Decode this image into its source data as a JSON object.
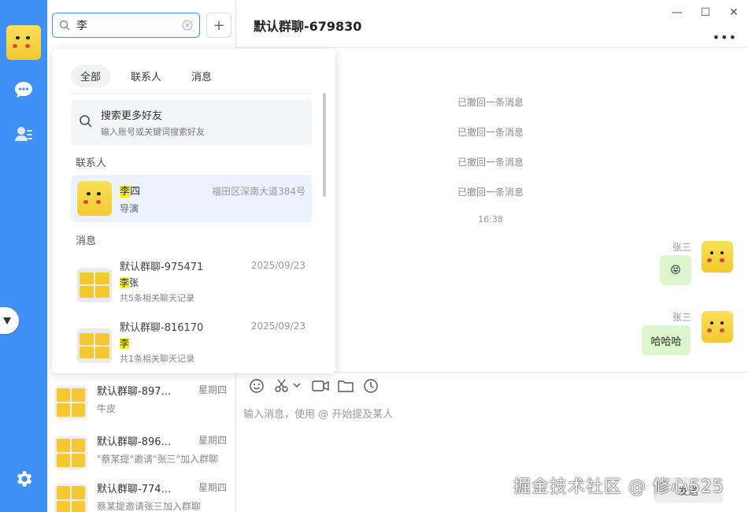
{
  "search": {
    "query": "李"
  },
  "chat": {
    "title": "默认群聊-679830",
    "system_messages": [
      "已撤回一条消息",
      "已撤回一条消息",
      "已撤回一条消息",
      "已撤回一条消息"
    ],
    "timestamp": "16:38",
    "messages": [
      {
        "sender": "张三",
        "text": "😝"
      },
      {
        "sender": "张三",
        "text": "哈哈哈"
      }
    ],
    "input_placeholder": "输入消息，使用 @ 开始提及某人",
    "send_label": "发送"
  },
  "dropdown": {
    "tabs": [
      "全部",
      "联系人",
      "消息"
    ],
    "more_friends": {
      "title": "搜索更多好友",
      "subtitle": "输入账号或关键词搜索好友"
    },
    "contacts_label": "联系人",
    "contact": {
      "name_highlight": "李",
      "name_rest": "四",
      "address": "福田区深南大道384号",
      "role": "导演"
    },
    "messages_label": "消息",
    "message_results": [
      {
        "name": "默认群聊-975471",
        "date": "2025/09/23",
        "highlight": "李",
        "rest": "张",
        "count_text": "共5条相关聊天记录"
      },
      {
        "name": "默认群聊-816170",
        "date": "2025/09/23",
        "highlight": "李",
        "rest": "",
        "count_text": "共1条相关聊天记录"
      }
    ]
  },
  "conversations": [
    {
      "name": "默认群聊-897…",
      "time": "星期四",
      "preview": "牛皮"
    },
    {
      "name": "默认群聊-896…",
      "time": "星期四",
      "preview": "\"蔡某提\"邀请\"张三\"加入群聊"
    },
    {
      "name": "默认群聊-774…",
      "time": "星期四",
      "preview": "蔡某提邀请张三加入群聊"
    }
  ],
  "watermark": "掘金技术社区 @ 修心525",
  "icons": {
    "nav": [
      "chat-icon",
      "contacts-icon",
      "settings-icon"
    ],
    "toolbar": [
      "emoji-icon",
      "scissors-icon",
      "video-icon",
      "folder-icon",
      "history-icon"
    ]
  },
  "colors": {
    "accent": "#3f91f7",
    "bubble": "#dcf5cd",
    "highlight": "#f6ef2f"
  }
}
